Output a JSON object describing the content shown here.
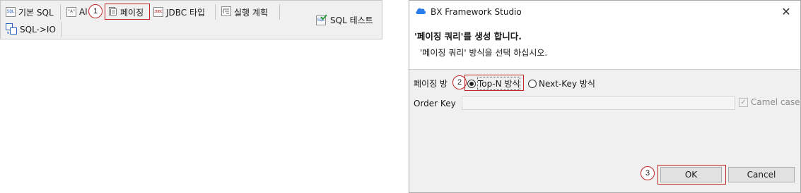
{
  "toolbar": {
    "basic_sql": "기본 SQL",
    "basic_sql_icon_text": "SQL",
    "all": "Al",
    "all_icon_text": "\"A\"",
    "paging": "페이징",
    "jdbc_type": "JDBC 타입",
    "jdbc_icon_text": "JDBC",
    "execution_plan": "실행 계획",
    "sql_test": "SQL 테스트",
    "sql_test_icon_text": "SQL",
    "sql_to_io": "SQL->IO"
  },
  "callouts": {
    "one": "1",
    "two": "2",
    "three": "3"
  },
  "dialog": {
    "title": "BX Framework Studio",
    "close_glyph": "✕",
    "header_title": "'페이징 쿼리'를 생성 합니다.",
    "header_desc": "'페이징 쿼리' 방식을 선택 하십시오.",
    "paging_label": "페이징 방",
    "options": {
      "top_n": "Top-N 방식",
      "next_key": "Next-Key 방식",
      "selected": "Top-N 방식"
    },
    "order_key_label": "Order Key",
    "order_key_value": "",
    "camel_case": "Camel case",
    "camel_case_checked": true,
    "ok": "OK",
    "cancel": "Cancel"
  },
  "colors": {
    "callout_red": "#c02626",
    "brand_blue": "#2b7de9"
  }
}
